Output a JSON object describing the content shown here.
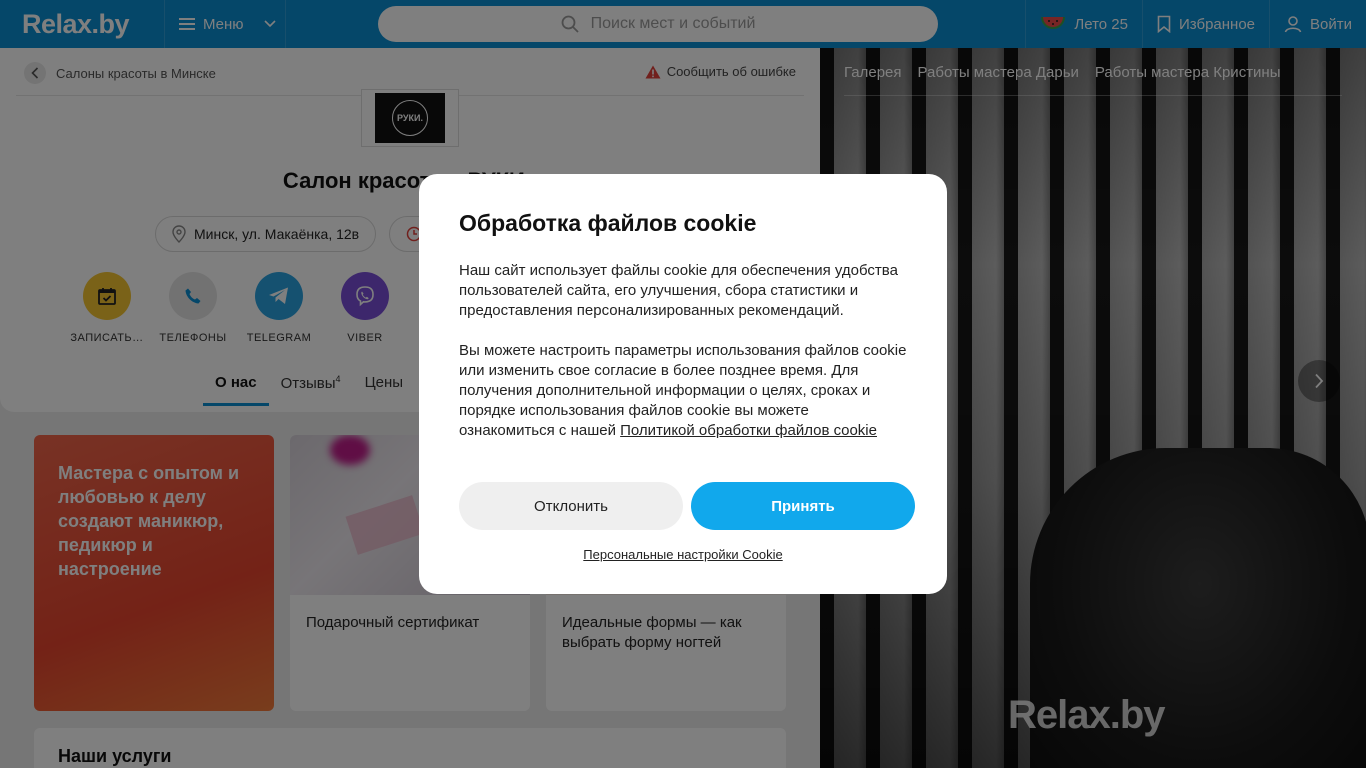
{
  "header": {
    "logo": "Relax.by",
    "menu_label": "Меню",
    "search_placeholder": "Поиск мест и событий",
    "summer_label": "Лето 25",
    "favorites_label": "Избранное",
    "login_label": "Войти",
    "bg_color": "#0a8fd3"
  },
  "breadcrumb": {
    "label": "Салоны красоты в Минске",
    "report_label": "Сообщить об ошибке"
  },
  "salon": {
    "logo_text": "РУКИ.",
    "title": "Салон красоты «РУКИ»",
    "address": "Минск, ул. Макаёнка, 12в",
    "actions": [
      {
        "label": "ЗАПИСАТЬ…",
        "color": "#f4c430",
        "icon": "calendar-icon"
      },
      {
        "label": "ТЕЛЕФОНЫ",
        "color": "#e4e4e4",
        "icon": "phone-icon"
      },
      {
        "label": "TELEGRAM",
        "color": "#2aa3e1",
        "icon": "telegram-icon"
      },
      {
        "label": "VIBER",
        "color": "#7b4fd8",
        "icon": "viber-icon"
      }
    ],
    "tabs": [
      {
        "label": "О нас",
        "active": true
      },
      {
        "label": "Отзывы",
        "badge": "4"
      },
      {
        "label": "Цены"
      }
    ]
  },
  "cards": {
    "promo_text": "Мастера с опытом и любовью к делу создают маникюр, педикюр и настроение",
    "article_1": "Подарочный сертификат",
    "article_2": "Идеальные формы — как выбрать форму ногтей",
    "services_title": "Наши услуги"
  },
  "gallery": {
    "tabs": [
      "Галерея",
      "Работы мастера Дарьи",
      "Работы мастера Кристины"
    ],
    "watermark": "Relax.by"
  },
  "cookie_modal": {
    "title": "Обработка файлов cookie",
    "paragraph_1": "Наш сайт использует файлы cookie для обеспечения удобства пользователей сайта, его улучшения, сбора статистики и предоставления персонализированных рекомендаций.",
    "paragraph_2": "Вы можете настроить параметры использования файлов cookie или изменить свое согласие в более позднее время. Для получения дополнительной информации о целях, сроках и порядке использования файлов cookie вы можете ознакомиться с нашей",
    "policy_link": "Политикой обработки файлов cookie",
    "decline_label": "Отклонить",
    "accept_label": "Принять",
    "personal_settings_label": "Персональные настройки Cookie",
    "accept_color": "#11a8ec"
  }
}
